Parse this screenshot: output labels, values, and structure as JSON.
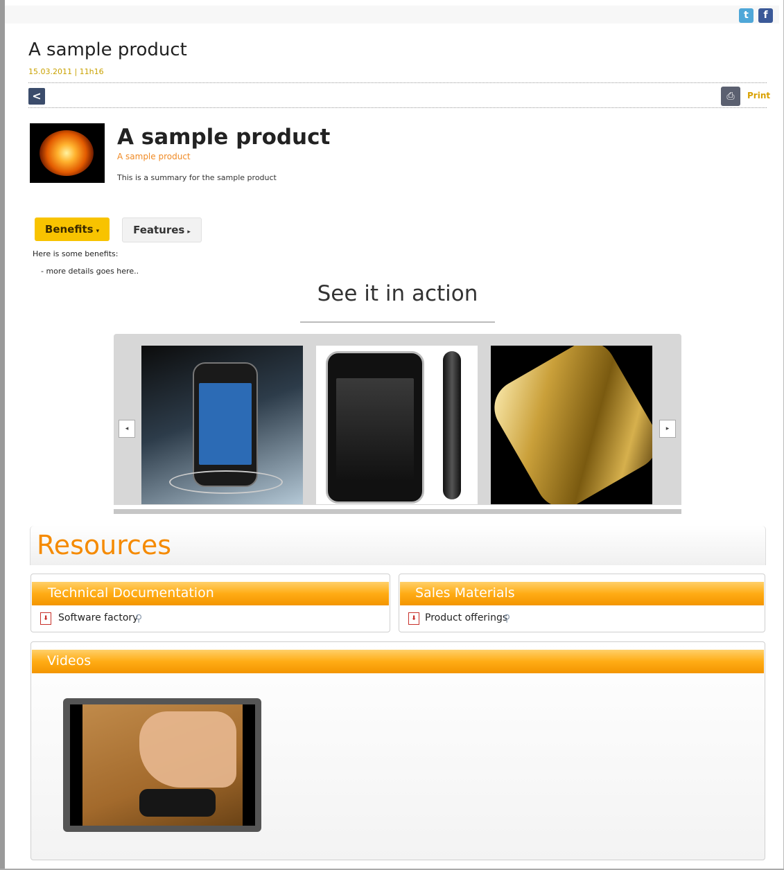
{
  "header": {
    "social": {
      "twitter_glyph": "t",
      "facebook_glyph": "f"
    },
    "title": "A sample product",
    "date": "15.03.2011 | 11h16",
    "back_glyph": "<",
    "print_label": "Print"
  },
  "product": {
    "title": "A sample product",
    "subtitle": "A sample product",
    "summary": "This is a summary for the sample product"
  },
  "tabs": [
    {
      "label": "Benefits",
      "arrow": "▾",
      "active": true
    },
    {
      "label": "Features",
      "arrow": "▸",
      "active": false
    }
  ],
  "benefits": {
    "intro": "Here is some benefits:",
    "detail": "- more details goes here.."
  },
  "gallery": {
    "heading": "See it in action",
    "prev_glyph": "◂",
    "next_glyph": "▸"
  },
  "resources": {
    "title": "Resources",
    "technical": {
      "title": "Technical Documentation",
      "items": [
        {
          "label": "Software factory"
        }
      ]
    },
    "sales": {
      "title": "Sales Materials",
      "items": [
        {
          "label": "Product offerings"
        }
      ]
    },
    "videos": {
      "title": "Videos"
    }
  },
  "icons": {
    "pdf": "pdf-icon",
    "magnifier": "magnifier-icon",
    "print": "printer-icon"
  },
  "colors": {
    "accent_orange": "#f58a00",
    "tab_yellow": "#f8c300",
    "date_gold": "#c9a100"
  }
}
